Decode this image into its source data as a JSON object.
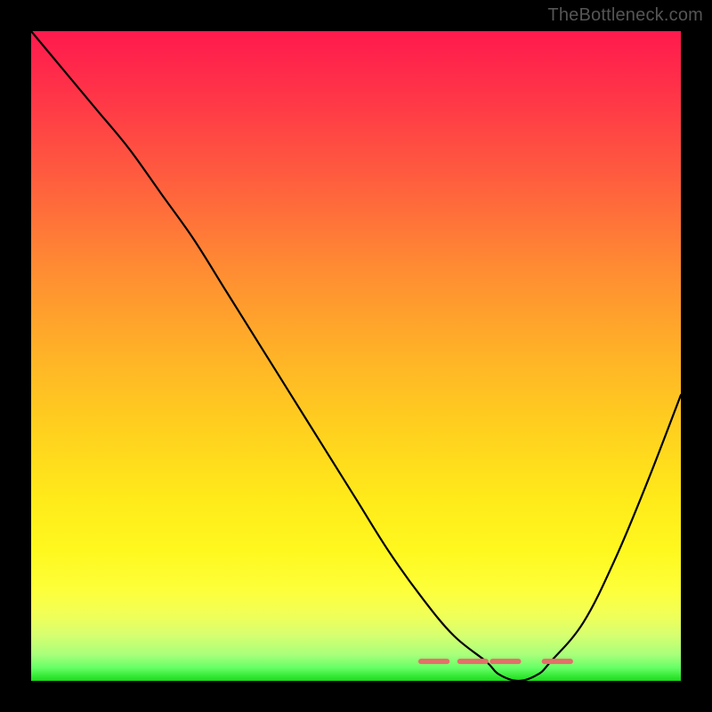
{
  "watermark": "TheBottleneck.com",
  "chart_data": {
    "type": "line",
    "title": "",
    "xlabel": "",
    "ylabel": "",
    "xlim": [
      0,
      100
    ],
    "ylim": [
      0,
      100
    ],
    "grid": false,
    "legend": false,
    "series": [
      {
        "name": "bottleneck-curve",
        "x": [
          0,
          5,
          10,
          15,
          20,
          25,
          30,
          35,
          40,
          45,
          50,
          55,
          60,
          65,
          70,
          72,
          75,
          78,
          80,
          85,
          90,
          95,
          100
        ],
        "values": [
          100,
          94,
          88,
          82,
          75,
          68,
          60,
          52,
          44,
          36,
          28,
          20,
          13,
          7,
          3,
          1,
          0,
          1,
          3,
          9,
          19,
          31,
          44
        ]
      }
    ],
    "gradient_stops": [
      {
        "pct": 0,
        "color": "#ff1a4d"
      },
      {
        "pct": 8,
        "color": "#ff2f49"
      },
      {
        "pct": 22,
        "color": "#ff5b3f"
      },
      {
        "pct": 36,
        "color": "#ff8a33"
      },
      {
        "pct": 50,
        "color": "#ffb327"
      },
      {
        "pct": 62,
        "color": "#ffd21e"
      },
      {
        "pct": 72,
        "color": "#ffea1a"
      },
      {
        "pct": 80,
        "color": "#fff81f"
      },
      {
        "pct": 86,
        "color": "#fdff3a"
      },
      {
        "pct": 90,
        "color": "#f0ff58"
      },
      {
        "pct": 93,
        "color": "#d6ff70"
      },
      {
        "pct": 96,
        "color": "#a8ff7a"
      },
      {
        "pct": 98,
        "color": "#66ff66"
      },
      {
        "pct": 100,
        "color": "#1adb1a"
      }
    ],
    "marker_band": {
      "name": "optimal-range-markers",
      "color": "#e36f6a",
      "y": 3,
      "segments": [
        {
          "x0": 60,
          "x1": 64
        },
        {
          "x0": 66,
          "x1": 70
        },
        {
          "x0": 71,
          "x1": 75
        },
        {
          "x0": 79,
          "x1": 83
        }
      ]
    }
  }
}
